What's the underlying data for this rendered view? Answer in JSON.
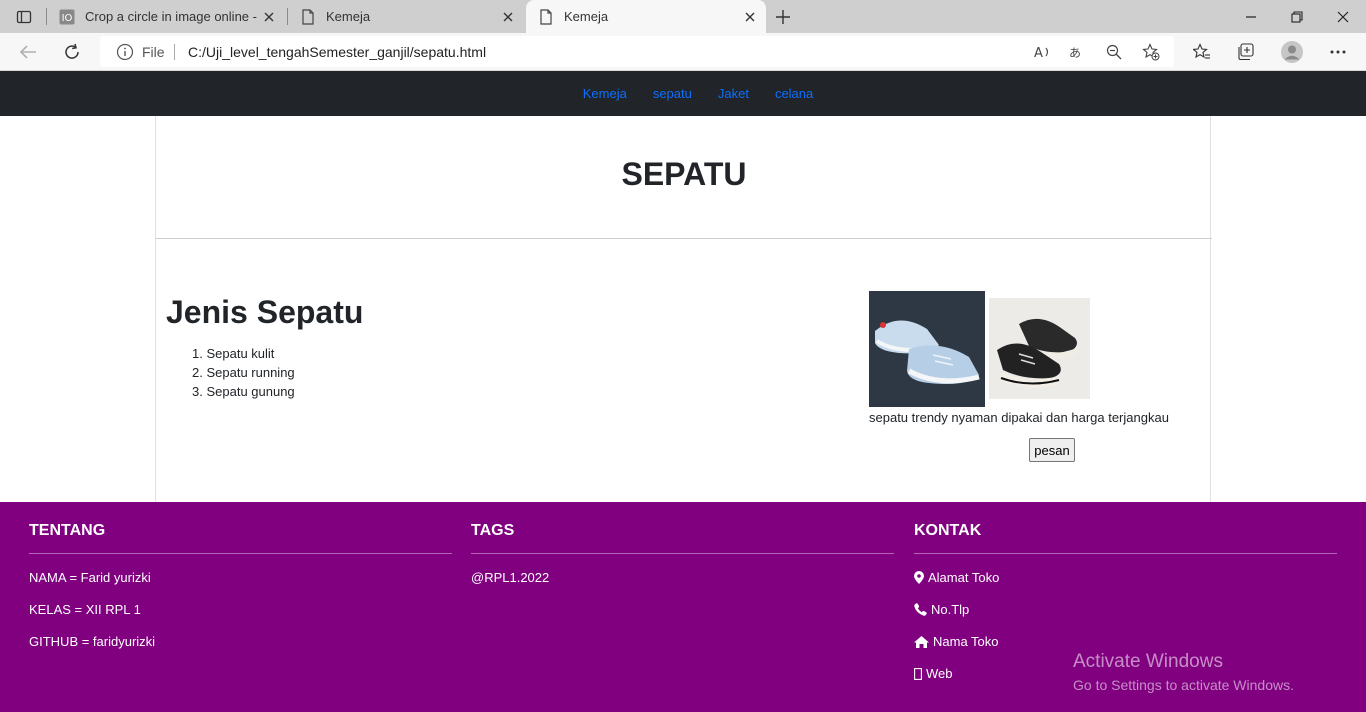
{
  "browser": {
    "tabs": [
      {
        "title": "Crop a circle in image online - fre"
      },
      {
        "title": "Kemeja"
      },
      {
        "title": "Kemeja",
        "active": true
      }
    ],
    "address": {
      "scheme_label": "File",
      "url": "C:/Uji_level_tengahSemester_ganjil/sepatu.html"
    }
  },
  "nav": {
    "links": [
      "Kemeja",
      "sepatu",
      "Jaket",
      "celana"
    ]
  },
  "main": {
    "page_title": "SEPATU",
    "section_title": "Jenis Sepatu",
    "list": [
      "Sepatu kulit",
      "Sepatu running",
      "Sepatu gunung"
    ],
    "caption": "sepatu trendy nyaman dipakai dan harga terjangkau",
    "order_button": "pesan"
  },
  "footer": {
    "tentang": {
      "title": "TENTANG",
      "rows": [
        "NAMA = Farid yurizki",
        "KELAS = XII RPL 1",
        "GITHUB = faridyurizki"
      ]
    },
    "tags": {
      "title": "TAGS",
      "rows": [
        "@RPL1.2022"
      ]
    },
    "kontak": {
      "title": "KONTAK",
      "rows": [
        "Alamat Toko",
        "No.Tlp",
        "Nama Toko",
        "Web"
      ]
    }
  },
  "watermark": {
    "line1": "Activate Windows",
    "line2": "Go to Settings to activate Windows."
  },
  "colors": {
    "nav_bg": "#212529",
    "link": "#0d6efd",
    "footer_bg": "#800080"
  }
}
